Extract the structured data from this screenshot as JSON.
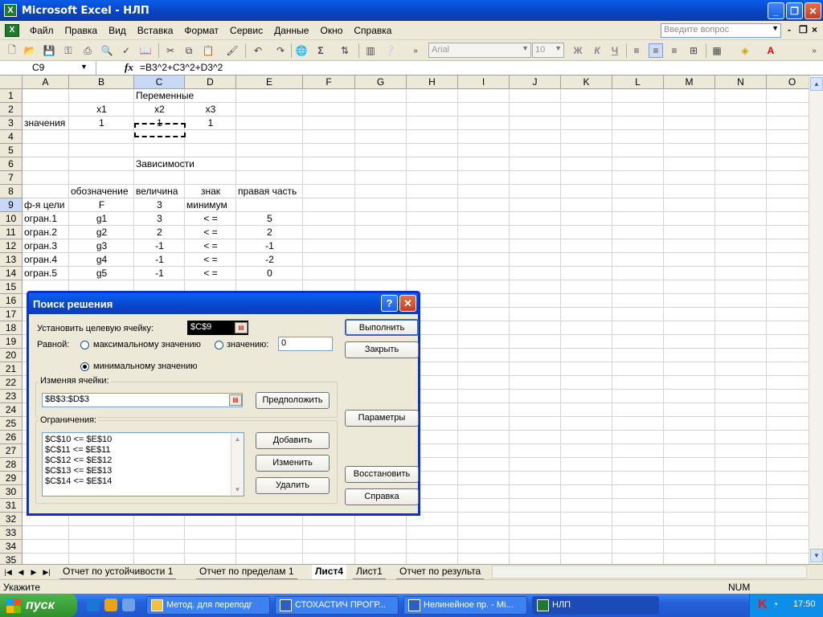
{
  "window": {
    "title": "Microsoft Excel - НЛП",
    "app_icon": "X"
  },
  "menu": {
    "items": [
      "Файл",
      "Правка",
      "Вид",
      "Вставка",
      "Формат",
      "Сервис",
      "Данные",
      "Окно",
      "Справка"
    ],
    "help_placeholder": "Введите вопрос",
    "mdi_close": "×"
  },
  "toolbar": {
    "font_name": "Arial",
    "font_size": "10",
    "bold": "Ж",
    "italic": "К",
    "underline": "Ч",
    "sigma": "Σ"
  },
  "formula_bar": {
    "cell_ref": "C9",
    "fx": "fx",
    "formula": "=B3^2+C3^2+D3^2"
  },
  "columns": [
    "A",
    "B",
    "C",
    "D",
    "E",
    "F",
    "G",
    "H",
    "I",
    "J",
    "K",
    "L",
    "M",
    "N",
    "O"
  ],
  "rows": [
    "1",
    "2",
    "3",
    "4",
    "5",
    "6",
    "7",
    "8",
    "9",
    "10",
    "11",
    "12",
    "13",
    "14",
    "15",
    "16",
    "17",
    "18",
    "19",
    "20",
    "21",
    "22",
    "23",
    "24",
    "25",
    "26",
    "27",
    "28",
    "29",
    "30",
    "31",
    "32",
    "33",
    "34",
    "35"
  ],
  "cells": {
    "c1": "Переменные",
    "b2": "x1",
    "c2": "x2",
    "d2": "x3",
    "a3": "значения",
    "b3": "1",
    "c3": "1",
    "d3": "1",
    "c6": "Зависимости",
    "b8": "обозначение",
    "c8": "величина",
    "d8": "знак",
    "e8": "правая часть",
    "a9": "ф-я цели",
    "b9": "F",
    "c9": "3",
    "d9": "минимум",
    "a10": "огран.1",
    "b10": "g1",
    "c10": "3",
    "d10": "< =",
    "e10": "5",
    "a11": "огран.2",
    "b11": "g2",
    "c11": "2",
    "d11": "< =",
    "e11": "2",
    "a12": "огран.3",
    "b12": "g3",
    "c12": "-1",
    "d12": "< =",
    "e12": "-1",
    "a13": "огран.4",
    "b13": "g4",
    "c13": "-1",
    "d13": "< =",
    "e13": "-2",
    "a14": "огран.5",
    "b14": "g5",
    "c14": "-1",
    "d14": "< =",
    "e14": "0"
  },
  "sheet_tabs": [
    "Отчет по устойчивости 1",
    "Отчет по пределам 1",
    "Лист4",
    "Лист1",
    "Отчет по результа"
  ],
  "active_tab": "Лист4",
  "status": {
    "left": "Укажите",
    "num": "NUM"
  },
  "taskbar": {
    "start": "пуск",
    "tasks": [
      "Метод. для переподг",
      "СТОХАСТИЧ ПРОГР...",
      "Нелинейное пр. - Mi...",
      "НЛП"
    ],
    "clock": "17:50"
  },
  "dialog": {
    "title": "Поиск решения",
    "target_label": "Установить целевую ячейку:",
    "target_value": "$C$9",
    "equal_label": "Равной:",
    "opt_max": "максимальному значению",
    "opt_value": "значению:",
    "value_field": "0",
    "opt_min": "минимальному значению",
    "selected_option": "min",
    "changing_label": "Изменяя ячейки:",
    "changing_value": "$B$3:$D$3",
    "guess_button": "Предположить",
    "constraints_label": "Ограничения:",
    "constraints": [
      "$C$10 <= $E$10",
      "$C$11 <= $E$11",
      "$C$12 <= $E$12",
      "$C$13 <= $E$13",
      "$C$14 <= $E$14"
    ],
    "add_button": "Добавить",
    "change_button": "Изменить",
    "delete_button": "Удалить",
    "solve_button": "Выполнить",
    "close_button": "Закрыть",
    "options_button": "Параметры",
    "reset_button": "Восстановить",
    "help_button": "Справка"
  }
}
